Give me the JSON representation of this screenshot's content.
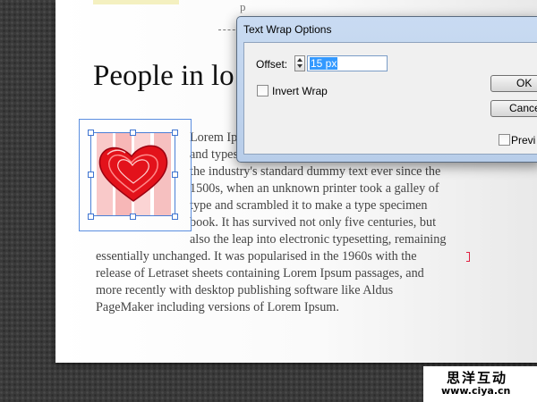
{
  "document": {
    "header_text": "p",
    "headline": "People in lo over the wo",
    "body_text": "Lorem Ipsum is simply dummy text of the printing and typesetting industry. Lorem Ipsum has been the industry's standard dummy text ever since the 1500s, when an unknown printer took a galley of type and scrambled it to make a type specimen book. It has survived not only five centuries, but also the leap into electronic typesetting, remaining essentially unchanged. It was popularised in the 1960s with the release of Letraset sheets containing Lorem Ipsum passages, and more recently with desktop publishing software like Aldus PageMaker including versions of Lorem Ipsum."
  },
  "image": {
    "icon": "heart-icon",
    "heart_color": "#e3121b",
    "stripe_color": "#f7b7b7"
  },
  "dialog": {
    "title": "Text Wrap Options",
    "offset_label": "Offset:",
    "offset_value": "15 px",
    "invert_wrap_label": "Invert Wrap",
    "invert_wrap_checked": false,
    "ok_label": "OK",
    "cancel_label": "Cance",
    "preview_label": "Previ",
    "preview_checked": false
  },
  "watermark": {
    "chinese": "思洋互动",
    "url": "www.ciya.cn"
  }
}
